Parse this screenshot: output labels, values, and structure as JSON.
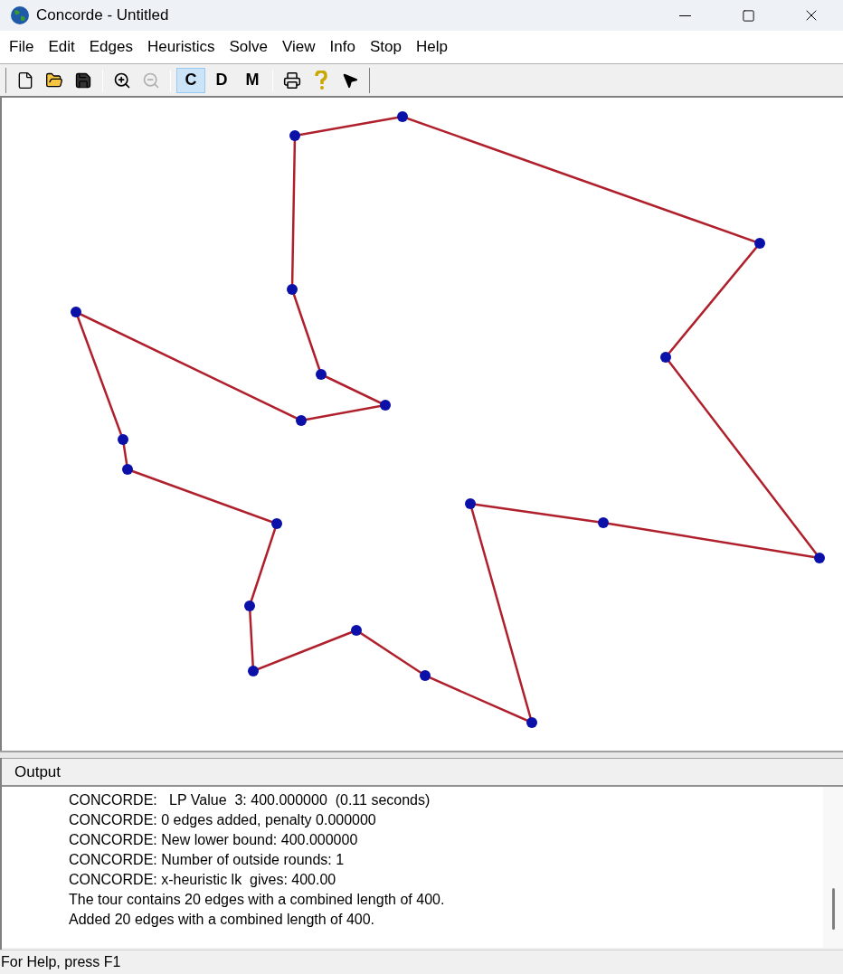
{
  "window": {
    "title": "Concorde - Untitled"
  },
  "menu": [
    "File",
    "Edit",
    "Edges",
    "Heuristics",
    "Solve",
    "View",
    "Info",
    "Stop",
    "Help"
  ],
  "toolbar": {
    "zoom_out": {
      "disabled": true
    },
    "mode_buttons": [
      {
        "label": "C",
        "selected": true
      },
      {
        "label": "D",
        "selected": false
      },
      {
        "label": "M",
        "selected": false
      }
    ]
  },
  "output": {
    "title": "Output",
    "lines": [
      "CONCORDE:   LP Value  3: 400.000000  (0.11 seconds)",
      "CONCORDE: 0 edges added, penalty 0.000000",
      "CONCORDE: New lower bound: 400.000000",
      "CONCORDE: Number of outside rounds: 1",
      "CONCORDE: x-heuristic lk  gives: 400.00",
      "The tour contains 20 edges with a combined length of 400.",
      "Added 20 edges with a combined length of 400."
    ]
  },
  "status_bar": "For Help, press F1"
}
